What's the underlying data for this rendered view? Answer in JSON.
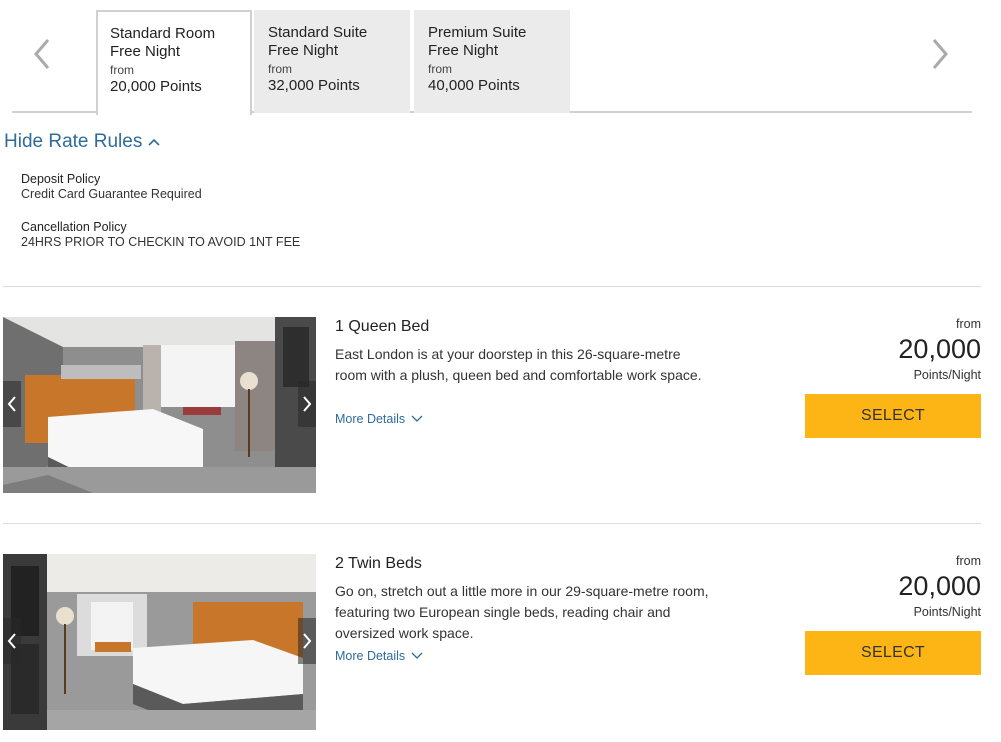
{
  "tabs": [
    {
      "line1": "Standard Room",
      "line2": "Free Night",
      "from": "from",
      "points": "20,000 Points",
      "active": true
    },
    {
      "line1": "Standard Suite",
      "line2": "Free Night",
      "from": "from",
      "points": "32,000 Points",
      "active": false
    },
    {
      "line1": "Premium Suite",
      "line2": "Free Night",
      "from": "from",
      "points": "40,000 Points",
      "active": false
    }
  ],
  "rate_rules": {
    "toggle_label": "Hide Rate Rules",
    "deposit": {
      "title": "Deposit Policy",
      "text": "Credit Card Guarantee Required"
    },
    "cancellation": {
      "title": "Cancellation Policy",
      "text": "24HRS PRIOR TO CHECKIN TO AVOID 1NT FEE"
    }
  },
  "rooms": [
    {
      "title": "1 Queen Bed",
      "description": "East London is at your doorstep in this 26-square-metre room with a plush, queen bed and comfortable work space.",
      "more_details": "More Details",
      "price_from": "from",
      "price": "20,000",
      "price_unit": "Points/Night",
      "select_label": "SELECT"
    },
    {
      "title": "2 Twin Beds",
      "description": "Go on, stretch out a little more in our 29-square-metre room, featuring two European single beds, reading chair and oversized work space.",
      "more_details": "More Details",
      "price_from": "from",
      "price": "20,000",
      "price_unit": "Points/Night",
      "select_label": "SELECT"
    }
  ],
  "colors": {
    "link": "#2f6c9a",
    "select_button": "#fdb515",
    "tab_inactive": "#ebebeb",
    "divider": "#dcdcdc"
  }
}
